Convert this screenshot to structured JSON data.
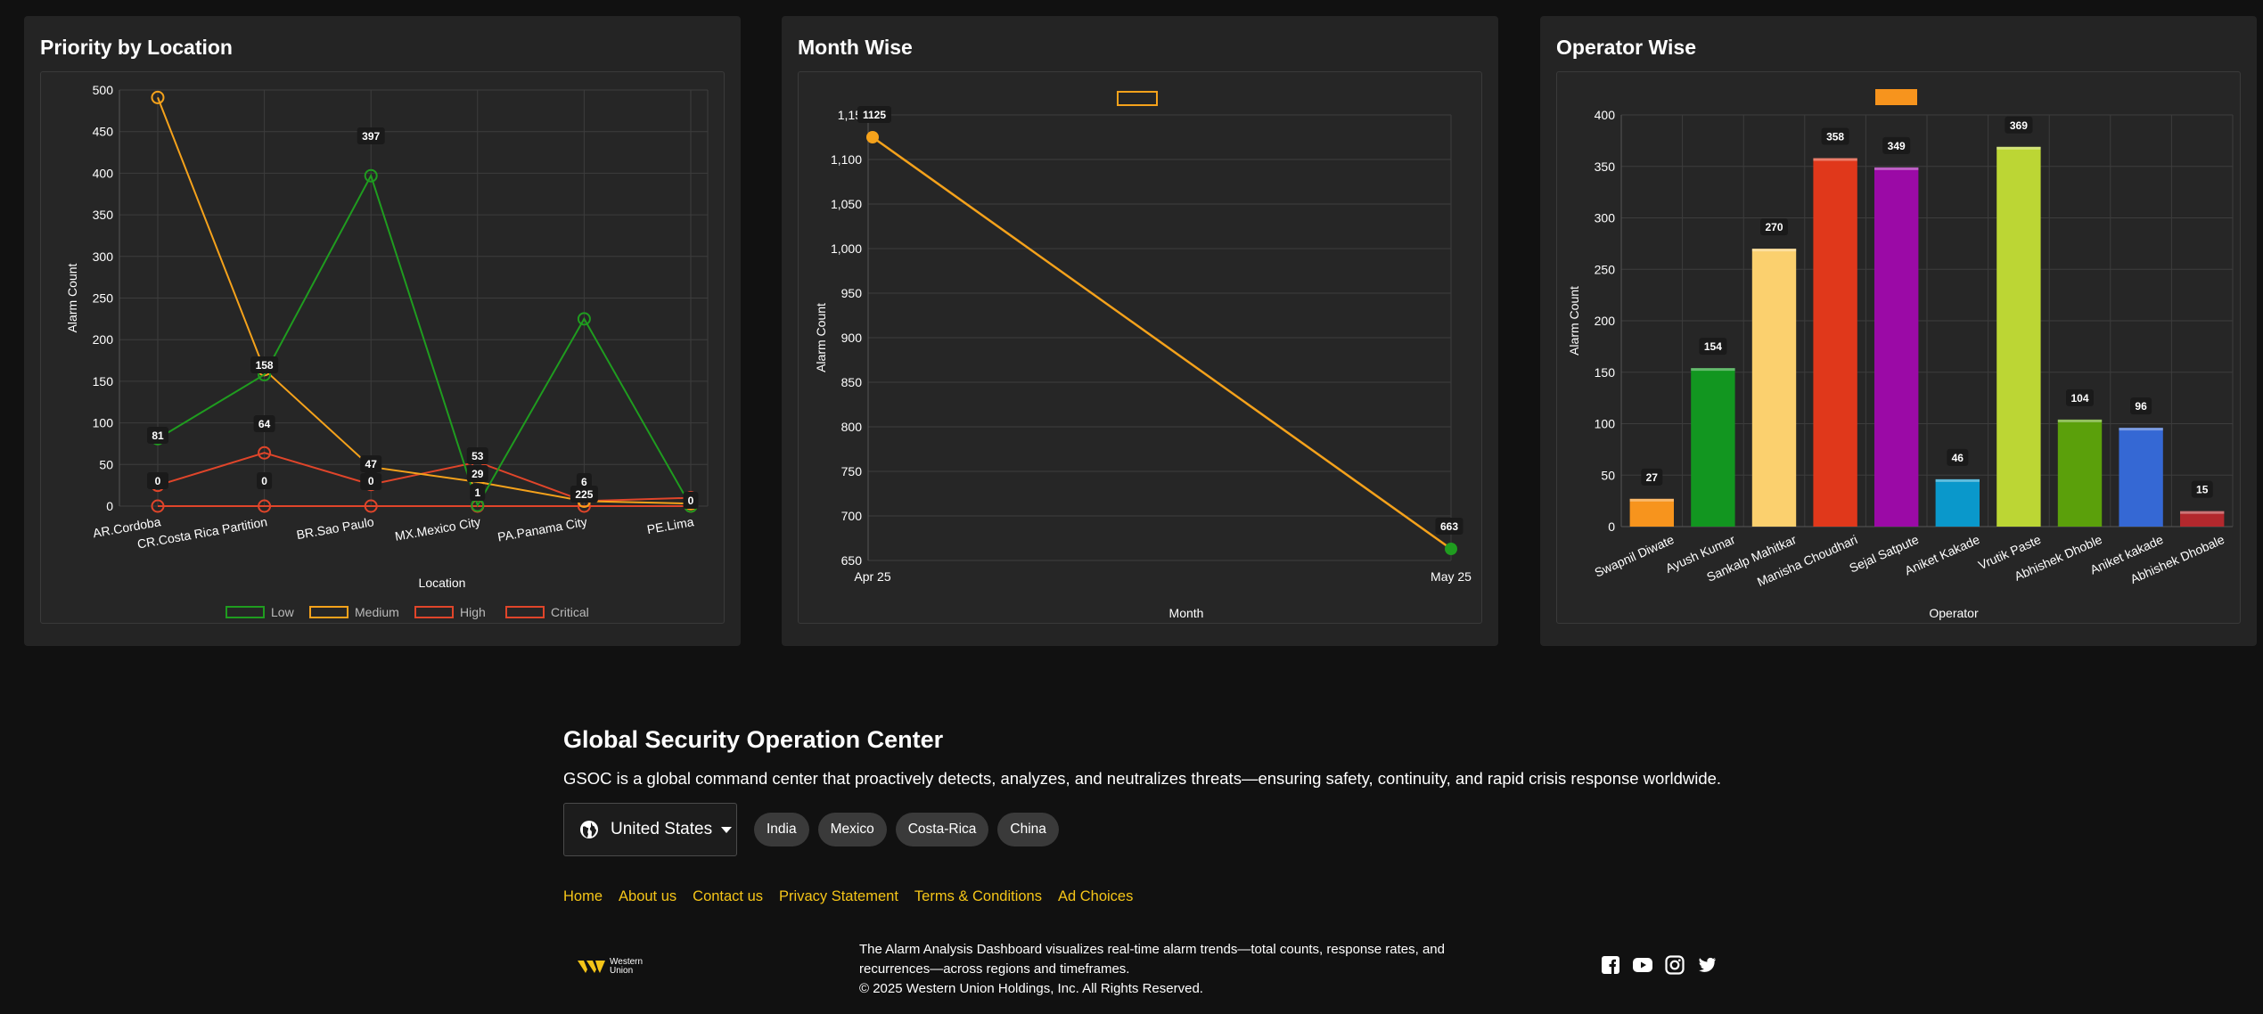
{
  "panels": {
    "location": {
      "title": "Priority by Location"
    },
    "month": {
      "title": "Month Wise"
    },
    "operator": {
      "title": "Operator Wise"
    }
  },
  "chart_data": [
    {
      "type": "line",
      "title": "Priority by Location",
      "xlabel": "Location",
      "ylabel": "Alarm Count",
      "categories": [
        "AR.Cordoba",
        "CR.Costa Rica Partition",
        "BR.Sao Paulo",
        "MX.Mexico City",
        "PA.Panama City",
        "PE.Lima"
      ],
      "ylim": [
        0,
        500
      ],
      "yticks": [
        0,
        50,
        100,
        150,
        200,
        250,
        300,
        350,
        400,
        450,
        500
      ],
      "grid": true,
      "legend": "bottom",
      "series": [
        {
          "name": "Low",
          "color": "#1f9c1f",
          "values": [
            81,
            158,
            397,
            1,
            225,
            0
          ]
        },
        {
          "name": "Medium",
          "color": "#f5a21b",
          "values": [
            491,
            164,
            47,
            29,
            6,
            3
          ]
        },
        {
          "name": "High",
          "color": "#e0452a",
          "values": [
            25,
            64,
            26,
            53,
            6,
            10
          ]
        },
        {
          "name": "Critical",
          "color": "#e0452a",
          "values": [
            0,
            0,
            0,
            0,
            0,
            0
          ]
        }
      ],
      "data_labels": [
        {
          "series": 0,
          "index": 0,
          "text": "81"
        },
        {
          "series": 2,
          "index": 0,
          "text": "25"
        },
        {
          "series": 3,
          "index": 0,
          "text": "0"
        },
        {
          "series": 1,
          "index": 1,
          "text": "158"
        },
        {
          "series": 2,
          "index": 1,
          "text": "64"
        },
        {
          "series": 3,
          "index": 1,
          "text": "0"
        },
        {
          "series": 0,
          "index": 2,
          "text": "397"
        },
        {
          "series": 1,
          "index": 2,
          "text": "47"
        },
        {
          "series": 2,
          "index": 2,
          "text": "26"
        },
        {
          "series": 3,
          "index": 2,
          "text": "0"
        },
        {
          "series": 2,
          "index": 3,
          "text": "53"
        },
        {
          "series": 1,
          "index": 3,
          "text": "29"
        },
        {
          "series": 0,
          "index": 3,
          "text": "1"
        },
        {
          "series": 0,
          "index": 4,
          "text": "225"
        },
        {
          "series": 2,
          "index": 4,
          "text": "6"
        },
        {
          "series": 3,
          "index": 5,
          "text": "0"
        }
      ]
    },
    {
      "type": "line",
      "title": "Month Wise",
      "xlabel": "Month",
      "ylabel": "Alarm Count",
      "categories": [
        "Apr 25",
        "May 25"
      ],
      "ylim": [
        650,
        1150
      ],
      "yticks": [
        650,
        700,
        750,
        800,
        850,
        900,
        950,
        1000,
        1050,
        1100,
        1150
      ],
      "ytick_labels": [
        "650",
        "700",
        "750",
        "800",
        "850",
        "900",
        "950",
        "1,000",
        "1,050",
        "1,100",
        "1,15"
      ],
      "grid": true,
      "legend": "top",
      "series": [
        {
          "name": "",
          "color": "#f5a21b",
          "values": [
            1125,
            663
          ],
          "point_colors": [
            "#f5a21b",
            "#1f9c1f"
          ]
        }
      ],
      "data_labels": [
        {
          "series": 0,
          "index": 0,
          "text": "1125"
        },
        {
          "series": 0,
          "index": 1,
          "text": "663"
        }
      ]
    },
    {
      "type": "bar",
      "title": "Operator Wise",
      "xlabel": "Operator",
      "ylabel": "Alarm Count",
      "categories": [
        "Swapnil Diwate",
        "Ayush Kumar",
        "Sankalp Mahitkar",
        "Manisha Choudhari",
        "Sejal Satpute",
        "Aniket Kakade",
        "Vrutik Paste",
        "Abhishek Dhoble",
        "Aniket kakade",
        "Abhishek Dhobale"
      ],
      "values": [
        27,
        154,
        270,
        358,
        349,
        46,
        369,
        104,
        96,
        15
      ],
      "colors": [
        "#f7941d",
        "#129620",
        "#fbd06e",
        "#e0381b",
        "#9b0aa6",
        "#0a98cb",
        "#bcd634",
        "#5ba00b",
        "#3568d4",
        "#b3282d"
      ],
      "ylim": [
        0,
        400
      ],
      "yticks": [
        0,
        50,
        100,
        150,
        200,
        250,
        300,
        350,
        400
      ],
      "grid": true,
      "legend": "top"
    }
  ],
  "footer": {
    "title": "Global Security Operation Center",
    "description": "GSOC is a global command center that proactively detects, analyzes, and neutralizes threats—ensuring safety, continuity, and rapid crisis response worldwide.",
    "region": "United States",
    "chips": [
      "India",
      "Mexico",
      "Costa-Rica",
      "China"
    ],
    "links": [
      "Home",
      "About us",
      "Contact us",
      "Privacy Statement",
      "Terms & Conditions",
      "Ad Choices"
    ],
    "logo_text_1": "Western",
    "logo_text_2": "Union",
    "copy_line_1": "The Alarm Analysis Dashboard visualizes real-time alarm trends—total counts, response rates, and",
    "copy_line_2": "recurrences—across regions and timeframes.",
    "copy_line_3": "© 2025 Western Union Holdings, Inc. All Rights Reserved.",
    "social_icons": [
      "facebook-icon",
      "youtube-icon",
      "instagram-icon",
      "twitter-icon"
    ]
  },
  "colors": {
    "accent_link": "#f5c518",
    "background": "#111111",
    "panel": "#242424"
  }
}
